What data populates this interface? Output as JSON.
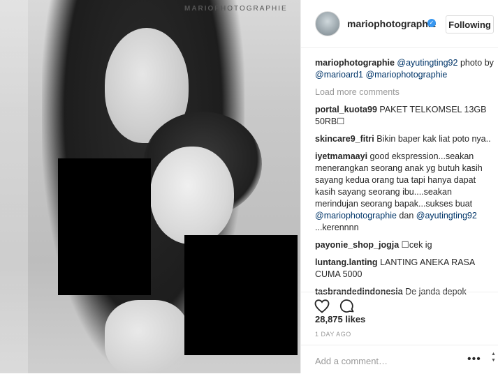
{
  "photo": {
    "watermark_bold": "MARIO",
    "watermark_rest": "PHOTOGRAPHIE"
  },
  "header": {
    "username": "mariophotographie",
    "follow_label": "Following"
  },
  "caption": {
    "user": "mariophotographie",
    "mention1": "@ayutingting92",
    "text1": "photo by",
    "mention2": "@marioard1",
    "mention3": "@mariophotographie"
  },
  "load_more": "Load more comments",
  "comments": [
    {
      "user": "portal_kuota99",
      "text": "PAKET TELKOMSEL 13GB 50RB☐"
    },
    {
      "user": "skincare9_fitri",
      "text": "Bikin baper kak liat poto nya.."
    },
    {
      "user": "iyetmamaayi",
      "text": "good ekspression...seakan menerangkan seorang anak yg butuh kasih sayang kedua orang tua tapi hanya dapat kasih sayang seorang ibu....seakan merindujan seorang bapak...sukses buat",
      "mention_a": "@mariophotographie",
      "joiner": "dan",
      "mention_b": "@ayutingting92",
      "tail": "...kerennnn"
    },
    {
      "user": "payonie_shop_jogja",
      "text": "☐cek ig"
    },
    {
      "user": "luntang.lanting",
      "text": "LANTING ANEKA RASA CUMA 5000"
    },
    {
      "user": "tasbrandedindonesia",
      "text": "De janda depok"
    }
  ],
  "likes": "28,875 likes",
  "time": "1 DAY AGO",
  "add_comment": {
    "placeholder": "Add a comment…"
  },
  "icons": {
    "like": "heart-icon",
    "comment": "speech-bubble-icon",
    "more": "ellipsis-icon"
  }
}
